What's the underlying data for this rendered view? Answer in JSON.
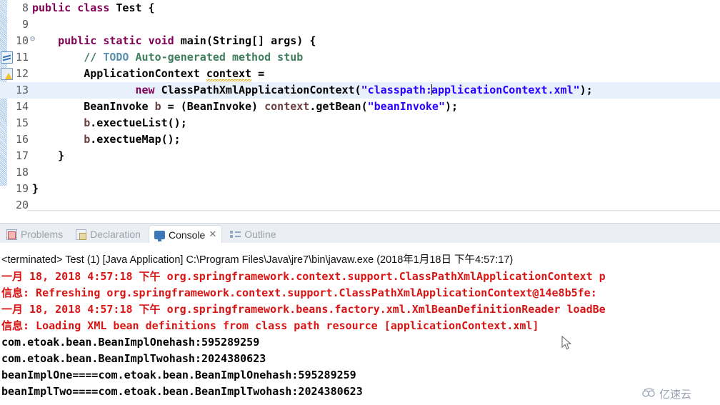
{
  "editor": {
    "name": "java-editor",
    "lines": [
      {
        "num": "8",
        "fold": "",
        "highlight": false,
        "indent": 0,
        "tokens": [
          {
            "t": "kw",
            "v": "public "
          },
          {
            "t": "kw",
            "v": "class "
          },
          {
            "t": "pln",
            "v": "Test {"
          }
        ]
      },
      {
        "num": "9",
        "fold": "",
        "highlight": false,
        "indent": 0,
        "tokens": []
      },
      {
        "num": "10",
        "fold": "⊖",
        "highlight": false,
        "indent": 0,
        "tokens": [
          {
            "t": "pln",
            "v": "    "
          },
          {
            "t": "kw",
            "v": "public "
          },
          {
            "t": "kw",
            "v": "static "
          },
          {
            "t": "kw",
            "v": "void "
          },
          {
            "t": "pln",
            "v": "main(String[] args) {"
          }
        ]
      },
      {
        "num": "11",
        "fold": "",
        "highlight": false,
        "indent": 0,
        "tokens": [
          {
            "t": "pln",
            "v": "        "
          },
          {
            "t": "cmt",
            "v": "// "
          },
          {
            "t": "todo",
            "v": "TODO"
          },
          {
            "t": "cmt",
            "v": " Auto-generated method stub"
          }
        ]
      },
      {
        "num": "12",
        "fold": "",
        "highlight": false,
        "indent": 0,
        "tokens": [
          {
            "t": "pln",
            "v": "        ApplicationContext "
          },
          {
            "t": "warn",
            "v": "context"
          },
          {
            "t": "pln",
            "v": " ="
          }
        ]
      },
      {
        "num": "13",
        "fold": "",
        "highlight": true,
        "indent": 0,
        "tokens": [
          {
            "t": "pln",
            "v": "                "
          },
          {
            "t": "kw",
            "v": "new "
          },
          {
            "t": "pln",
            "v": "ClassPathXmlApplicationContext("
          },
          {
            "t": "str",
            "v": "\"classpath:"
          },
          {
            "t": "caret",
            "v": ""
          },
          {
            "t": "str",
            "v": "applicationContext.xml\""
          },
          {
            "t": "pln",
            "v": ");"
          }
        ]
      },
      {
        "num": "14",
        "fold": "",
        "highlight": false,
        "indent": 0,
        "tokens": [
          {
            "t": "pln",
            "v": "        BeanInvoke "
          },
          {
            "t": "var",
            "v": "b"
          },
          {
            "t": "pln",
            "v": " = (BeanInvoke) "
          },
          {
            "t": "var",
            "v": "context"
          },
          {
            "t": "pln",
            "v": ".getBean("
          },
          {
            "t": "str",
            "v": "\"beanInvoke\""
          },
          {
            "t": "pln",
            "v": ");"
          }
        ]
      },
      {
        "num": "15",
        "fold": "",
        "highlight": false,
        "indent": 0,
        "tokens": [
          {
            "t": "pln",
            "v": "        "
          },
          {
            "t": "var",
            "v": "b"
          },
          {
            "t": "pln",
            "v": ".exectueList();"
          }
        ]
      },
      {
        "num": "16",
        "fold": "",
        "highlight": false,
        "indent": 0,
        "tokens": [
          {
            "t": "pln",
            "v": "        "
          },
          {
            "t": "var",
            "v": "b"
          },
          {
            "t": "pln",
            "v": ".exectueMap();"
          }
        ]
      },
      {
        "num": "17",
        "fold": "",
        "highlight": false,
        "indent": 0,
        "tokens": [
          {
            "t": "pln",
            "v": "    }"
          }
        ]
      },
      {
        "num": "18",
        "fold": "",
        "highlight": false,
        "indent": 0,
        "tokens": []
      },
      {
        "num": "19",
        "fold": "",
        "highlight": false,
        "indent": 0,
        "tokens": [
          {
            "t": "pln",
            "v": "}"
          }
        ]
      },
      {
        "num": "20",
        "fold": "",
        "highlight": false,
        "indent": 0,
        "tokens": []
      }
    ],
    "gutter_markers": [
      {
        "icon": "todo-task-icon",
        "line": 11
      },
      {
        "icon": "warning-marker-icon",
        "line": 12
      }
    ],
    "scrollbar_left_arrow": "‹"
  },
  "tabbar": {
    "tabs": [
      {
        "label": "Problems",
        "icon": "problems-icon",
        "active": false,
        "closable": false
      },
      {
        "label": "Declaration",
        "icon": "declaration-icon",
        "active": false,
        "closable": false
      },
      {
        "label": "Console",
        "icon": "console-icon",
        "active": true,
        "closable": true,
        "close_glyph": "✕"
      },
      {
        "label": "Outline",
        "icon": "outline-icon",
        "active": false,
        "closable": false
      }
    ]
  },
  "console": {
    "header": "<terminated> Test (1) [Java Application] C:\\Program Files\\Java\\jre7\\bin\\javaw.exe (2018年1月18日 下午4:57:17)",
    "lines": [
      {
        "kind": "err",
        "text": "一月 18, 2018 4:57:18 下午 org.springframework.context.support.ClassPathXmlApplicationContext p"
      },
      {
        "kind": "err",
        "text": "信息: Refreshing org.springframework.context.support.ClassPathXmlApplicationContext@14e8b5fe:"
      },
      {
        "kind": "err",
        "text": "一月 18, 2018 4:57:18 下午 org.springframework.beans.factory.xml.XmlBeanDefinitionReader loadBe"
      },
      {
        "kind": "err",
        "text": "信息: Loading XML bean definitions from class path resource [applicationContext.xml]"
      },
      {
        "kind": "out",
        "text": "com.etoak.bean.BeanImplOnehash:595289259"
      },
      {
        "kind": "out",
        "text": "com.etoak.bean.BeanImplTwohash:2024380623"
      },
      {
        "kind": "out",
        "text": "beanImplOne====com.etoak.bean.BeanImplOnehash:595289259"
      },
      {
        "kind": "out",
        "text": "beanImplTwo====com.etoak.bean.BeanImplTwohash:2024380623"
      }
    ]
  },
  "watermark": {
    "text": "亿速云",
    "icon": "cloud-icon"
  },
  "colors": {
    "keyword": "#7f0055",
    "string": "#2a00ff",
    "comment": "#3f7f5f",
    "todo": "#5c8fad",
    "local_var": "#6a3e3e",
    "console_error": "#d81515",
    "console_out": "#000000",
    "line_highlight": "#e8f0fb",
    "tab_active_bg": "#ffffff",
    "tabbar_bg": "#ebeef3"
  }
}
